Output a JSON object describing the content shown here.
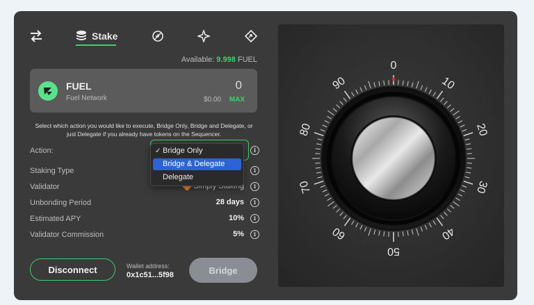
{
  "nav": {
    "tabs": [
      {
        "icon": "swap-arrows-icon"
      },
      {
        "icon": "coin-stack-icon",
        "label": "Stake",
        "active": true
      },
      {
        "icon": "leaf-icon"
      },
      {
        "icon": "sparkle-icon"
      },
      {
        "icon": "diamond-arrow-icon"
      }
    ]
  },
  "available": {
    "label": "Available:",
    "amount": "9.998",
    "unit": "FUEL"
  },
  "token": {
    "symbol": "FUEL",
    "network": "Fuel Network",
    "amount": "0",
    "usd": "$0.00",
    "max_label": "MAX",
    "logo_color": "#58e28a"
  },
  "hint": "Select which action you would like to execute, Bridge Only, Bridge and Delegate, or just Delegate if you already have tokens on the Sequencer.",
  "form": {
    "action_label": "Action:",
    "staking_type_label": "Staking Type",
    "validator_label": "Validator",
    "validator_value": "Simply Staking",
    "unbonding_label": "Unbonding Period",
    "unbonding_value": "28 days",
    "apy_label": "Estimated APY",
    "apy_value": "10%",
    "commission_label": "Validator Commission",
    "commission_value": "5%"
  },
  "dropdown": {
    "options": [
      {
        "label": "Bridge Only",
        "checked": true,
        "highlighted": false
      },
      {
        "label": "Bridge & Delegate",
        "checked": false,
        "highlighted": true
      },
      {
        "label": "Delegate",
        "checked": false,
        "highlighted": false
      }
    ],
    "check_glyph": "✓"
  },
  "wallet": {
    "label": "Wallet address:",
    "address": "0x1c51...5f98"
  },
  "buttons": {
    "disconnect": "Disconnect",
    "bridge": "Bridge"
  },
  "dial": {
    "labels": [
      "0",
      "10",
      "20",
      "30",
      "40",
      "50",
      "60",
      "70",
      "80",
      "90"
    ]
  },
  "colors": {
    "accent": "#3fcf6a",
    "panel": "#3a3a3a",
    "highlight": "#2c64d8"
  }
}
